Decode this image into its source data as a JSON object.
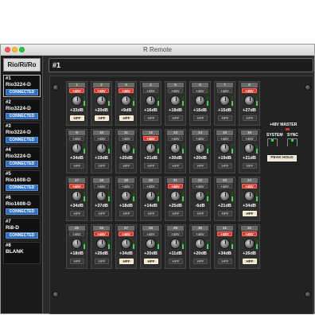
{
  "window": {
    "title": "R Remote"
  },
  "sidebar": {
    "header": "Rio/Ri/Ro",
    "devices": [
      {
        "num": "#1",
        "name": "Rio3224-D",
        "status": "CONNECTED",
        "active": true
      },
      {
        "num": "#2",
        "name": "Rio3224-D",
        "status": "CONNECTED",
        "active": false
      },
      {
        "num": "#3",
        "name": "Rio3224-D",
        "status": "CONNECTED",
        "active": false
      },
      {
        "num": "#4",
        "name": "Rio3224-D",
        "status": "CONNECTED",
        "active": false
      },
      {
        "num": "#5",
        "name": "Rio1608-D",
        "status": "CONNECTED",
        "active": false
      },
      {
        "num": "#6",
        "name": "Rio1608-D",
        "status": "CONNECTED",
        "active": false
      },
      {
        "num": "#7",
        "name": "Ri8-D",
        "status": "CONNECTED",
        "active": false
      },
      {
        "num": "#8",
        "name": "BLANK",
        "status": "",
        "active": false
      }
    ]
  },
  "header": {
    "title": "#1"
  },
  "labels": {
    "phantom": "+48V",
    "hpf": "HPF"
  },
  "channels": [
    {
      "num": "1",
      "phantom": true,
      "gain": "+33dB",
      "hpf": true
    },
    {
      "num": "2",
      "phantom": true,
      "gain": "+20dB",
      "hpf": true
    },
    {
      "num": "3",
      "phantom": true,
      "gain": "+9dB",
      "hpf": true
    },
    {
      "num": "4",
      "phantom": false,
      "gain": "+16dB",
      "hpf": false
    },
    {
      "num": "5",
      "phantom": false,
      "gain": "+18dB",
      "hpf": false
    },
    {
      "num": "6",
      "phantom": false,
      "gain": "+16dB",
      "hpf": false
    },
    {
      "num": "7",
      "phantom": false,
      "gain": "+15dB",
      "hpf": false
    },
    {
      "num": "8",
      "phantom": true,
      "gain": "+27dB",
      "hpf": false
    },
    {
      "num": "9",
      "phantom": false,
      "gain": "+34dB",
      "hpf": false
    },
    {
      "num": "10",
      "phantom": false,
      "gain": "+19dB",
      "hpf": false
    },
    {
      "num": "11",
      "phantom": false,
      "gain": "+20dB",
      "hpf": false
    },
    {
      "num": "12",
      "phantom": true,
      "gain": "+21dB",
      "hpf": false
    },
    {
      "num": "13",
      "phantom": false,
      "gain": "+30dB",
      "hpf": false
    },
    {
      "num": "14",
      "phantom": false,
      "gain": "+20dB",
      "hpf": false
    },
    {
      "num": "15",
      "phantom": false,
      "gain": "+19dB",
      "hpf": false
    },
    {
      "num": "16",
      "phantom": false,
      "gain": "+21dB",
      "hpf": false
    },
    {
      "num": "17",
      "phantom": true,
      "gain": "+34dB",
      "hpf": false
    },
    {
      "num": "18",
      "phantom": false,
      "gain": "+37dB",
      "hpf": false
    },
    {
      "num": "19",
      "phantom": false,
      "gain": "+18dB",
      "hpf": false
    },
    {
      "num": "20",
      "phantom": false,
      "gain": "+14dB",
      "hpf": false
    },
    {
      "num": "21",
      "phantom": true,
      "gain": "+25dB",
      "hpf": false
    },
    {
      "num": "22",
      "phantom": false,
      "gain": "-6dB",
      "hpf": false
    },
    {
      "num": "23",
      "phantom": false,
      "gain": "+21dB",
      "hpf": false
    },
    {
      "num": "24",
      "phantom": true,
      "gain": "+34dB",
      "hpf": true
    },
    {
      "num": "25",
      "phantom": false,
      "gain": "+18dB",
      "hpf": false
    },
    {
      "num": "26",
      "phantom": true,
      "gain": "+26dB",
      "hpf": false
    },
    {
      "num": "27",
      "phantom": true,
      "gain": "+34dB",
      "hpf": true
    },
    {
      "num": "28",
      "phantom": false,
      "gain": "+20dB",
      "hpf": true
    },
    {
      "num": "29",
      "phantom": false,
      "gain": "+11dB",
      "hpf": false
    },
    {
      "num": "30",
      "phantom": false,
      "gain": "+20dB",
      "hpf": false
    },
    {
      "num": "31",
      "phantom": true,
      "gain": "+34dB",
      "hpf": false
    },
    {
      "num": "32",
      "phantom": true,
      "gain": "+26dB",
      "hpf": true
    }
  ],
  "master": {
    "title": "+48V MASTER",
    "system_label": "SYSTEM",
    "sync_label": "SYNC",
    "peak_hold_label": "PEAK HOLD"
  }
}
